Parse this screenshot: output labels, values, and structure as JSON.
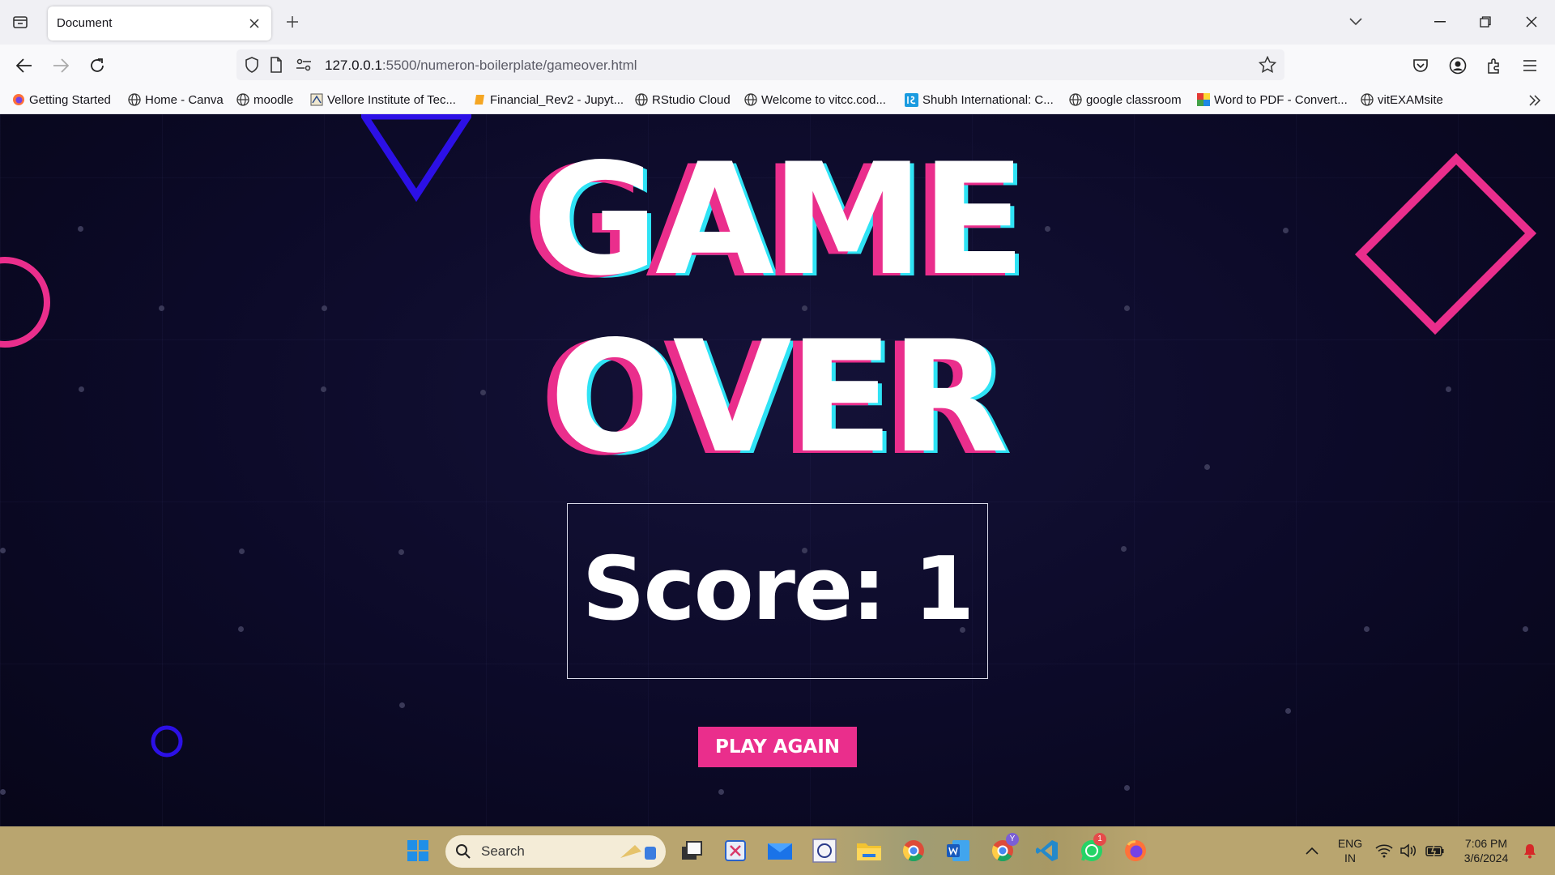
{
  "browser": {
    "tab_title": "Document",
    "url_host": "127.0.0.1",
    "url_path": ":5500/numeron-boilerplate/gameover.html",
    "bookmarks": [
      {
        "label": "Getting Started"
      },
      {
        "label": "Home - Canva"
      },
      {
        "label": "moodle"
      },
      {
        "label": "Vellore Institute of Tec..."
      },
      {
        "label": "Financial_Rev2 - Jupyt..."
      },
      {
        "label": "RStudio Cloud"
      },
      {
        "label": "Welcome to vitcc.cod..."
      },
      {
        "label": "Shubh International: C..."
      },
      {
        "label": "google classroom"
      },
      {
        "label": "Word to PDF - Convert..."
      },
      {
        "label": "vitEXAMsite"
      }
    ]
  },
  "game": {
    "title_line1": "GAME",
    "title_line2": "OVER",
    "score_text": "Score: 1",
    "play_again_label": "PLAY AGAIN",
    "colors": {
      "pink": "#ea2e8c",
      "blue": "#2c10e6",
      "cyan": "#2fe3f5",
      "bg": "#0c0a28"
    }
  },
  "taskbar": {
    "search_label": "Search",
    "language_line1": "ENG",
    "language_line2": "IN",
    "time": "7:06 PM",
    "date": "3/6/2024",
    "whatsapp_badge": "1",
    "chrome_profile_badge": "Y"
  }
}
